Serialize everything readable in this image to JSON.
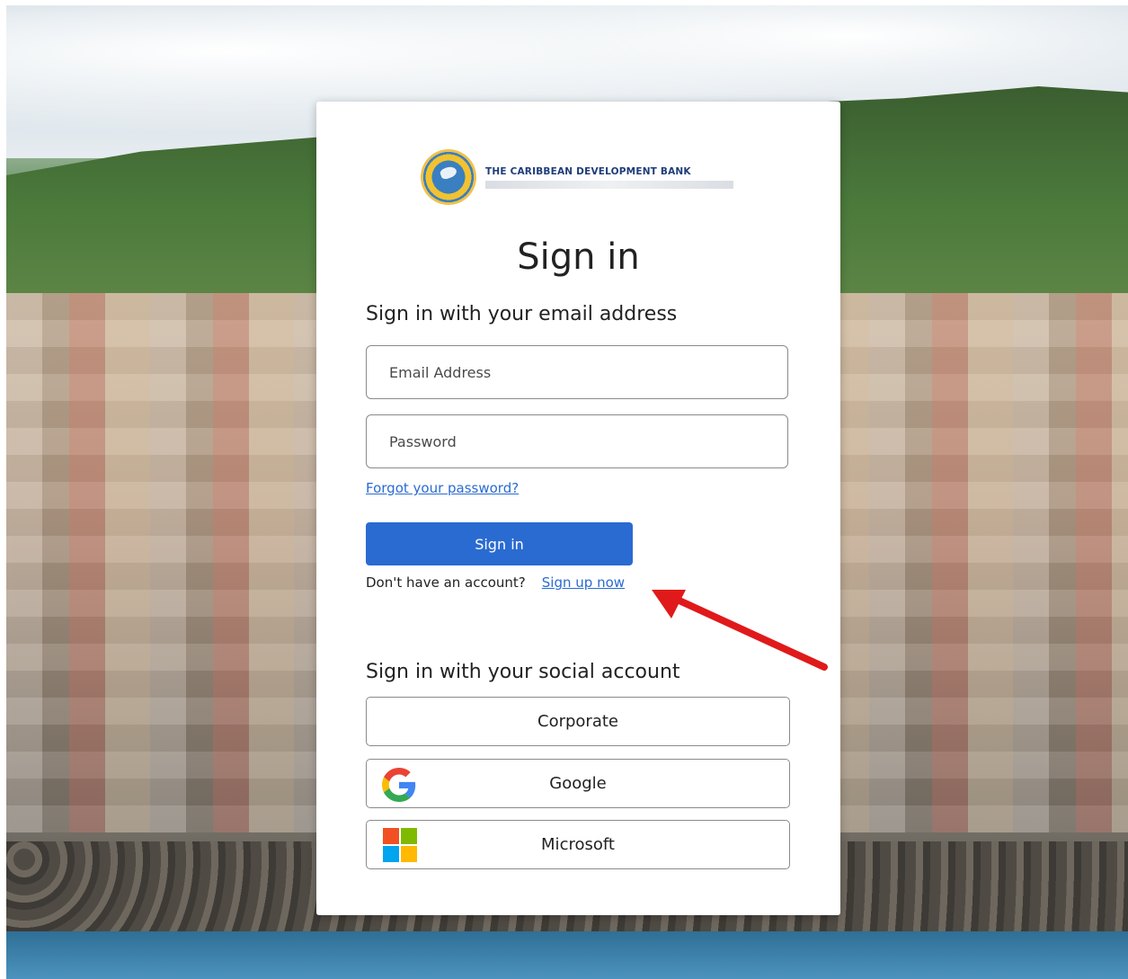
{
  "brand": {
    "name": "THE CARIBBEAN DEVELOPMENT BANK"
  },
  "page": {
    "title": "Sign in",
    "local_heading": "Sign in with your email address",
    "social_heading": "Sign in with your social account"
  },
  "form": {
    "email_placeholder": "Email Address",
    "password_placeholder": "Password",
    "forgot_link": "Forgot your password?",
    "submit_label": "Sign in",
    "no_account_text": "Don't have an account?",
    "signup_link": "Sign up now"
  },
  "social": {
    "corporate_label": "Corporate",
    "google_label": "Google",
    "microsoft_label": "Microsoft"
  },
  "colors": {
    "primary": "#2a6bd1",
    "annotation_arrow": "#e01a1a"
  },
  "icons": {
    "google": "google-icon",
    "microsoft": "microsoft-icon",
    "annotation": "red-arrow-icon"
  }
}
